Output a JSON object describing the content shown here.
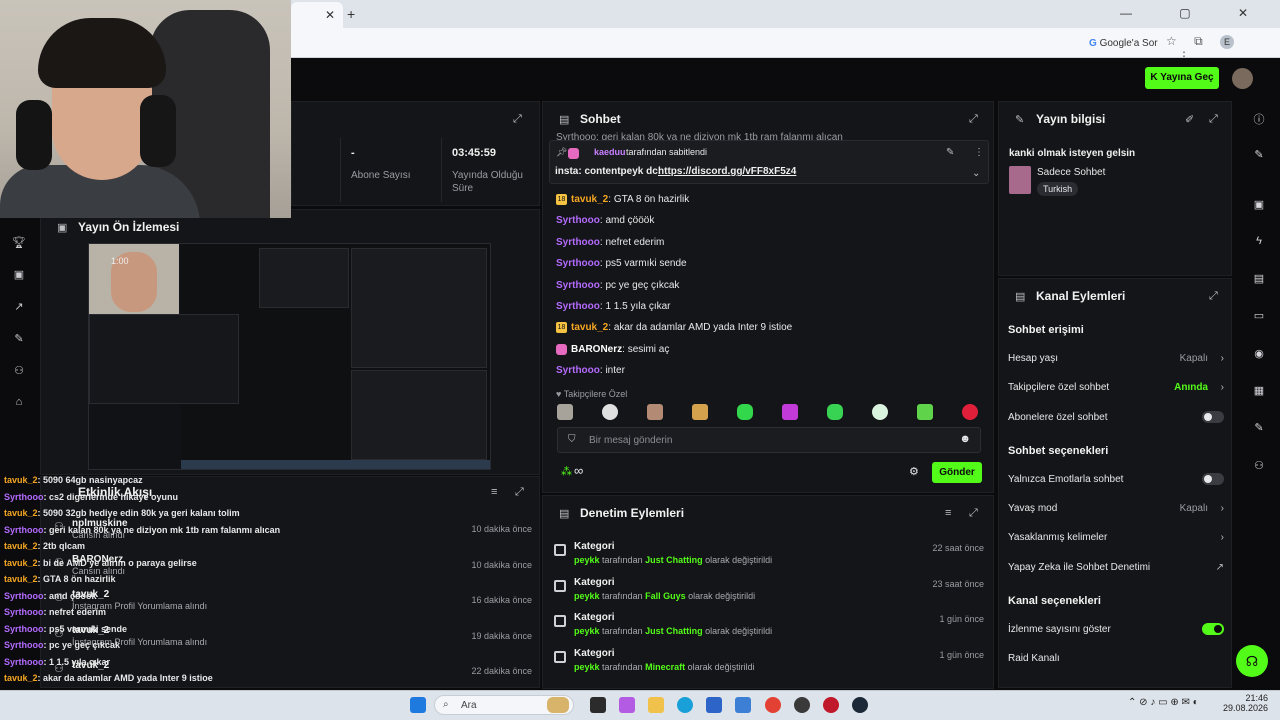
{
  "browser": {
    "tab_close": "✕",
    "new_tab": "+",
    "window_controls": "—  ▢  ✕",
    "google_chip": "Google'a Sor",
    "profile_letter": "E"
  },
  "topbar": {
    "go_live_label": "Yayına Geç"
  },
  "stats": {
    "cells": [
      {
        "value": "-",
        "label": "Abone Sayısı"
      },
      {
        "value": "03:45:59",
        "label": "Yayında Olduğu Süre"
      }
    ]
  },
  "preview_panel": {
    "title": "Yayın Ön İzlemesi",
    "overlay_time": "1:00"
  },
  "activity": {
    "title": "Etkinlik Akışı",
    "rows": [
      {
        "name": "nplmuskine",
        "sub": "Cansın alındı",
        "time": "10 dakika önce"
      },
      {
        "name": "BARONerz",
        "sub": "Cansın alındı",
        "time": "10 dakika önce"
      },
      {
        "name": "tavuk_2",
        "sub": "İnstagram Profil Yorumlama alındı",
        "time": "16 dakika önce"
      },
      {
        "name": "tavuk_2",
        "sub": "İnstagram Profil Yorumlama alındı",
        "time": "19 dakika önce"
      },
      {
        "name": "tavuk_2",
        "sub": "",
        "time": "22 dakika önce"
      }
    ],
    "feed": [
      {
        "user": "tavuk_2",
        "text": ": 5090 64gb nasinyapcaz",
        "color": "orange"
      },
      {
        "user": "Syrthooo",
        "text": ": cs2 digerlerinde hikaye oyunu",
        "color": "purple"
      },
      {
        "user": "tavuk_2",
        "text": ": 5090 32gb hediye edin 80k ya geri kalanı tolim",
        "color": "orange"
      },
      {
        "user": "Syrthooo",
        "text": ": geri kalan 80k ya ne diziyon mk 1tb ram falanmı alıcan",
        "color": "purple"
      },
      {
        "user": "tavuk_2",
        "text": ": 2tb qlcam",
        "color": "orange"
      },
      {
        "user": "tavuk_2",
        "text": ": bi de AMD ye alırım o paraya gelirse",
        "color": "orange"
      },
      {
        "user": "tavuk_2",
        "text": ": GTA 8 ön hazirlik",
        "color": "orange"
      },
      {
        "user": "Syrthooo",
        "text": ": amd çööök",
        "color": "purple"
      },
      {
        "user": "Syrthooo",
        "text": ": nefret ederim",
        "color": "purple"
      },
      {
        "user": "Syrthooo",
        "text": ": ps5 varmıki sende",
        "color": "purple"
      },
      {
        "user": "Syrthooo",
        "text": ": pc ye geç çıkcak",
        "color": "purple"
      },
      {
        "user": "Syrthooo",
        "text": ": 1 1.5 yıla çıkar",
        "color": "purple"
      },
      {
        "user": "tavuk_2",
        "text": ": akar da adamlar AMD yada Inter 9 istioe",
        "color": "orange"
      },
      {
        "user": "BARONerz",
        "text": ": sesimi aç",
        "color": "white"
      },
      {
        "user": "Syrthooo",
        "text": ": inter",
        "color": "purple"
      }
    ]
  },
  "chat": {
    "title": "Sohbet",
    "top_cut_line": "Syrthooo: geri kalan 80k ya ne diziyon mk 1tb ram falanmı alıcan",
    "pinned": {
      "by": "kaeduu",
      "suffix": "tarafından sabitlendi",
      "text_prefix": "insta: contentpeyk dc:",
      "link": "https://discord.gg/vFF8xF5z4"
    },
    "messages": [
      {
        "user": "tavuk_2",
        "text": "GTA 8 ön hazirlik",
        "color": "orange",
        "badge": "18"
      },
      {
        "user": "Syrthooo",
        "text": "amd çööök",
        "color": "purple",
        "badge": ""
      },
      {
        "user": "Syrthooo",
        "text": "nefret ederim",
        "color": "purple",
        "badge": ""
      },
      {
        "user": "Syrthooo",
        "text": "ps5 varmıki sende",
        "color": "purple",
        "badge": ""
      },
      {
        "user": "Syrthooo",
        "text": "pc ye geç çıkcak",
        "color": "purple",
        "badge": ""
      },
      {
        "user": "Syrthooo",
        "text": "1 1.5 yıla çıkar",
        "color": "purple",
        "badge": ""
      },
      {
        "user": "tavuk_2",
        "text": "akar da adamlar AMD yada Inter 9 istioe",
        "color": "orange",
        "badge": "18"
      },
      {
        "user": "BARONerz",
        "text": "sesimi aç",
        "color": "white",
        "badge": "pink"
      },
      {
        "user": "Syrthooo",
        "text": "inter",
        "color": "purple",
        "badge": ""
      }
    ],
    "emotes_label": "Takipçilere Özel",
    "input_placeholder": "Bir mesaj gönderin",
    "infinity": "∞",
    "send_label": "Gönder"
  },
  "moderation": {
    "title": "Denetim Eylemleri",
    "rows": [
      {
        "title": "Kategori",
        "user": "peykk",
        "mid": "tarafından",
        "category": "Just Chatting",
        "end": "olarak değiştirildi",
        "time": "22 saat önce"
      },
      {
        "title": "Kategori",
        "user": "peykk",
        "mid": "tarafından",
        "category": "Fall Guys",
        "end": "olarak değiştirildi",
        "time": "23 saat önce"
      },
      {
        "title": "Kategori",
        "user": "peykk",
        "mid": "tarafından",
        "category": "Just Chatting",
        "end": "olarak değiştirildi",
        "time": "1 gün önce"
      },
      {
        "title": "Kategori",
        "user": "peykk",
        "mid": "tarafından",
        "category": "Minecraft",
        "end": "olarak değiştirildi",
        "time": "1 gün önce"
      }
    ]
  },
  "stream_info": {
    "title": "Yayın bilgisi",
    "stream_title": "kanki olmak isteyen gelsin",
    "category": "Sadece Sohbet",
    "language": "Turkish"
  },
  "channel_actions": {
    "title": "Kanal Eylemleri",
    "chat_access_header": "Sohbet erişimi",
    "account_age": {
      "label": "Hesap yaşı",
      "value": "Kapalı"
    },
    "followers_only": {
      "label": "Takipçilere özel sohbet",
      "value": "Anında"
    },
    "subscribers_only": {
      "label": "Abonelere özel sohbet"
    },
    "chat_options_header": "Sohbet seçenekleri",
    "emote_only": {
      "label": "Yalnızca Emotlarla sohbet"
    },
    "slow_mode": {
      "label": "Yavaş mod",
      "value": "Kapalı"
    },
    "banned_words": {
      "label": "Yasaklanmış kelimeler"
    },
    "ai_moderation": {
      "label": "Yapay Zeka ile Sohbet Denetimi"
    },
    "channel_options_header": "Kanal seçenekleri",
    "show_viewers": {
      "label": "İzlenme sayısını göster"
    },
    "raid_channel": {
      "label": "Raid Kanalı"
    }
  },
  "taskbar": {
    "search_label": "Ara",
    "time": "21:46",
    "date": "29.08.2026"
  },
  "colors": {
    "accent": "#53fc18",
    "purple_user": "#b36bff",
    "orange_user": "#f5a623",
    "panel": "#141518"
  }
}
